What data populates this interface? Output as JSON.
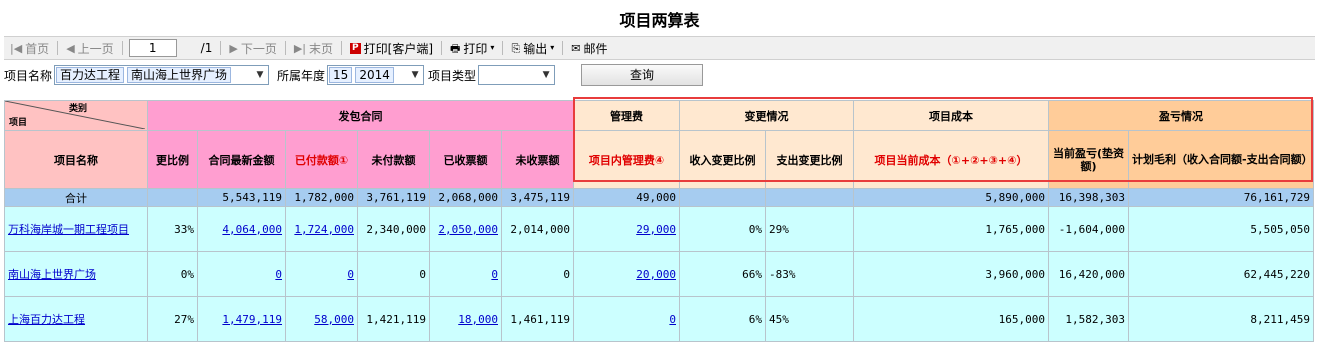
{
  "title": "项目两算表",
  "toolbar": {
    "first": "首页",
    "prev": "上一页",
    "page_value": "1",
    "page_total": "/1",
    "next": "下一页",
    "last": "末页",
    "print_client": "打印[客户端]",
    "print": "打印",
    "export": "输出",
    "mail": "邮件"
  },
  "filters": {
    "project_name_label": "项目名称",
    "project_name_tags": [
      "百力达工程",
      "南山海上世界广场"
    ],
    "year_label": "所属年度",
    "year_tags": [
      "15",
      "2014"
    ],
    "type_label": "项目类型",
    "type_value": "",
    "query_button": "查询"
  },
  "table": {
    "corner_top": "类别",
    "corner_bottom": "项目",
    "groups": {
      "contract": "发包合同",
      "mgmt": "管理费",
      "change": "变更情况",
      "cost": "项目成本",
      "profit": "盈亏情况"
    },
    "columns": {
      "name": "项目名称",
      "change_ratio": "更比例",
      "contract_amount": "合同最新金额",
      "paid": "已付款额①",
      "unpaid": "未付款额",
      "invoiced": "已收票额",
      "uninvoiced": "未收票额",
      "inner_mgmt": "项目内管理费④",
      "income_change": "收入变更比例",
      "expense_change": "支出变更比例",
      "current_cost": "项目当前成本（①+②+③+④）",
      "current_pl": "当前盈亏(垫资额)",
      "planned_margin": "计划毛利（收入合同额-支出合同额）"
    },
    "total": {
      "label": "合计",
      "change_ratio": "",
      "contract_amount": "5,543,119",
      "paid": "1,782,000",
      "unpaid": "3,761,119",
      "invoiced": "2,068,000",
      "uninvoiced": "3,475,119",
      "inner_mgmt": "49,000",
      "income_change": "",
      "expense_change": "",
      "current_cost": "5,890,000",
      "current_pl": "16,398,303",
      "planned_margin": "76,161,729"
    },
    "rows": [
      {
        "name": "万科海岸城一期工程项目",
        "change_ratio": "33%",
        "contract_amount": "4,064,000",
        "paid": "1,724,000",
        "unpaid": "2,340,000",
        "invoiced": "2,050,000",
        "uninvoiced": "2,014,000",
        "inner_mgmt": "29,000",
        "income_change": "0%",
        "expense_change": "29%",
        "current_cost": "1,765,000",
        "current_pl": "-1,604,000",
        "planned_margin": "5,505,050"
      },
      {
        "name": "南山海上世界广场",
        "change_ratio": "0%",
        "contract_amount": "0",
        "paid": "0",
        "unpaid": "0",
        "invoiced": "0",
        "uninvoiced": "0",
        "inner_mgmt": "20,000",
        "income_change": "66%",
        "expense_change": "-83%",
        "current_cost": "3,960,000",
        "current_pl": "16,420,000",
        "planned_margin": "62,445,220"
      },
      {
        "name": "上海百力达工程",
        "change_ratio": "27%",
        "contract_amount": "1,479,119",
        "paid": "58,000",
        "unpaid": "1,421,119",
        "invoiced": "18,000",
        "uninvoiced": "1,461,119",
        "inner_mgmt": "0",
        "income_change": "6%",
        "expense_change": "45%",
        "current_cost": "165,000",
        "current_pl": "1,582,303",
        "planned_margin": "8,211,459"
      }
    ]
  }
}
